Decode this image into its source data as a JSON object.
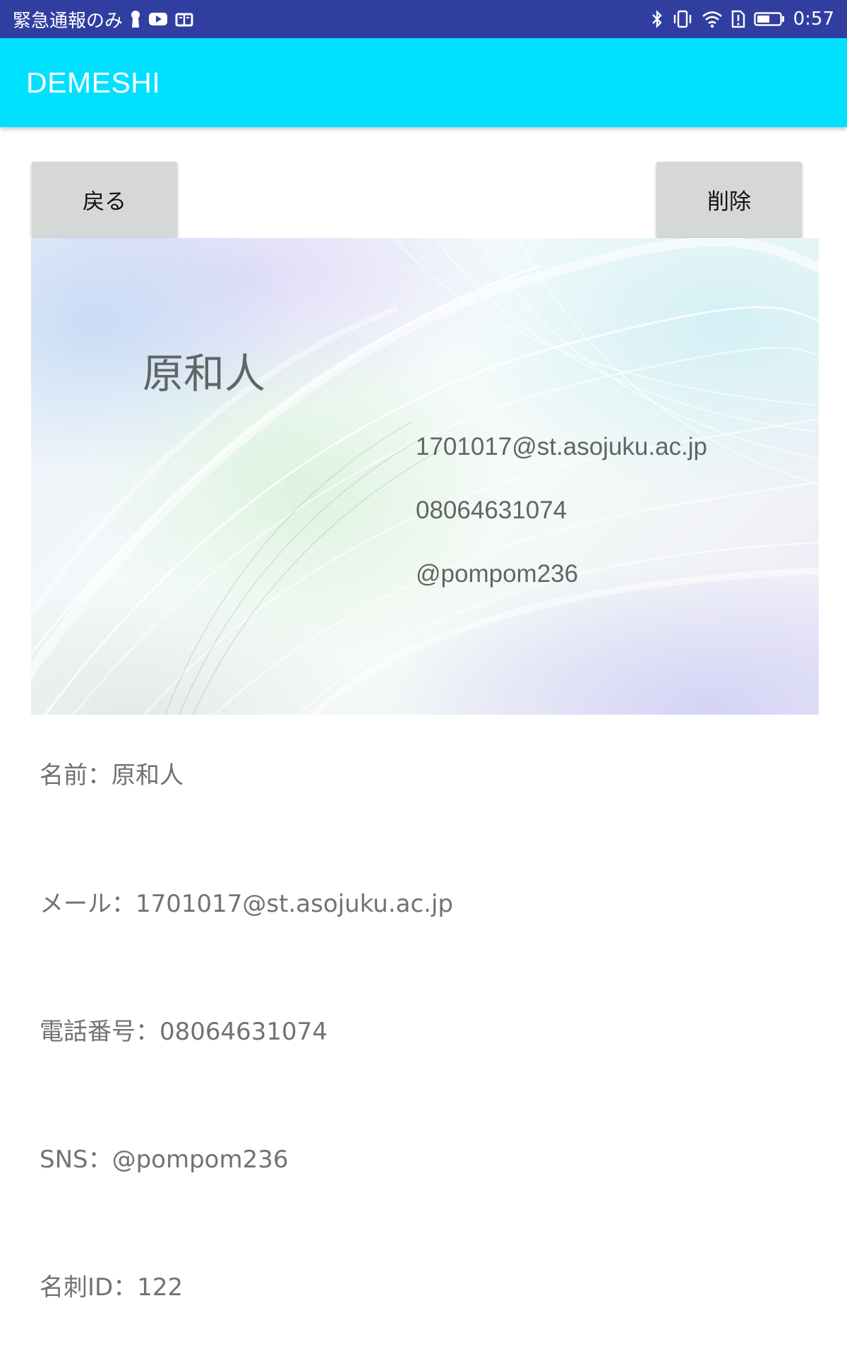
{
  "status_bar": {
    "carrier_text": "緊急通報のみ",
    "time": "0:57",
    "left_icons": [
      "keyhole-icon",
      "youtube-icon",
      "book-icon"
    ],
    "right_icons": [
      "bluetooth-icon",
      "vibrate-icon",
      "wifi-icon",
      "sim-alert-icon",
      "battery-icon"
    ]
  },
  "app_bar": {
    "title": "DEMESHI"
  },
  "buttons": {
    "back_label": "戻る",
    "delete_label": "削除"
  },
  "card": {
    "name": "原和人",
    "email": "1701017@st.asojuku.ac.jp",
    "phone": "08064631074",
    "sns": "@pompom236"
  },
  "details": {
    "name": "名前：原和人",
    "email": "メール：1701017@st.asojuku.ac.jp",
    "phone": "電話番号：08064631074",
    "sns": "SNS：@pompom236",
    "card_id": "名刺ID：122"
  },
  "colors": {
    "status_bar": "#303f9f",
    "app_bar": "#00e0ff",
    "button": "#d6d7d7",
    "detail_text": "#6f7471",
    "card_text": "#5f6663"
  }
}
